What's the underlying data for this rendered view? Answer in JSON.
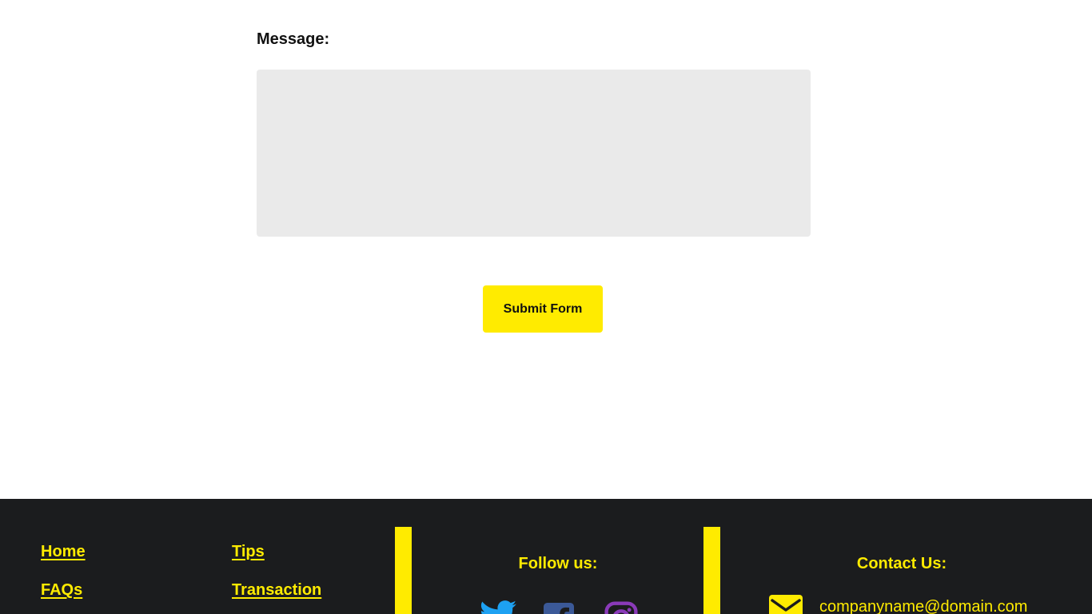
{
  "form": {
    "message_label": "Message:",
    "message_value": "",
    "submit_label": "Submit Form"
  },
  "footer": {
    "links_col1": [
      "Home",
      "FAQs"
    ],
    "links_col2": [
      "Tips",
      "Transaction"
    ],
    "follow_heading": "Follow us:",
    "social_icons": [
      "twitter-icon",
      "facebook-icon",
      "instagram-icon"
    ],
    "contact_heading": "Contact Us:",
    "email": "companyname@domain.com"
  },
  "colors": {
    "accent": "#ffeb00",
    "footer_bg": "#1b1c1e",
    "textarea_bg": "#eaeaea",
    "twitter": "#1da1f2",
    "facebook": "#3b5998",
    "instagram": "#8a3ab9"
  }
}
